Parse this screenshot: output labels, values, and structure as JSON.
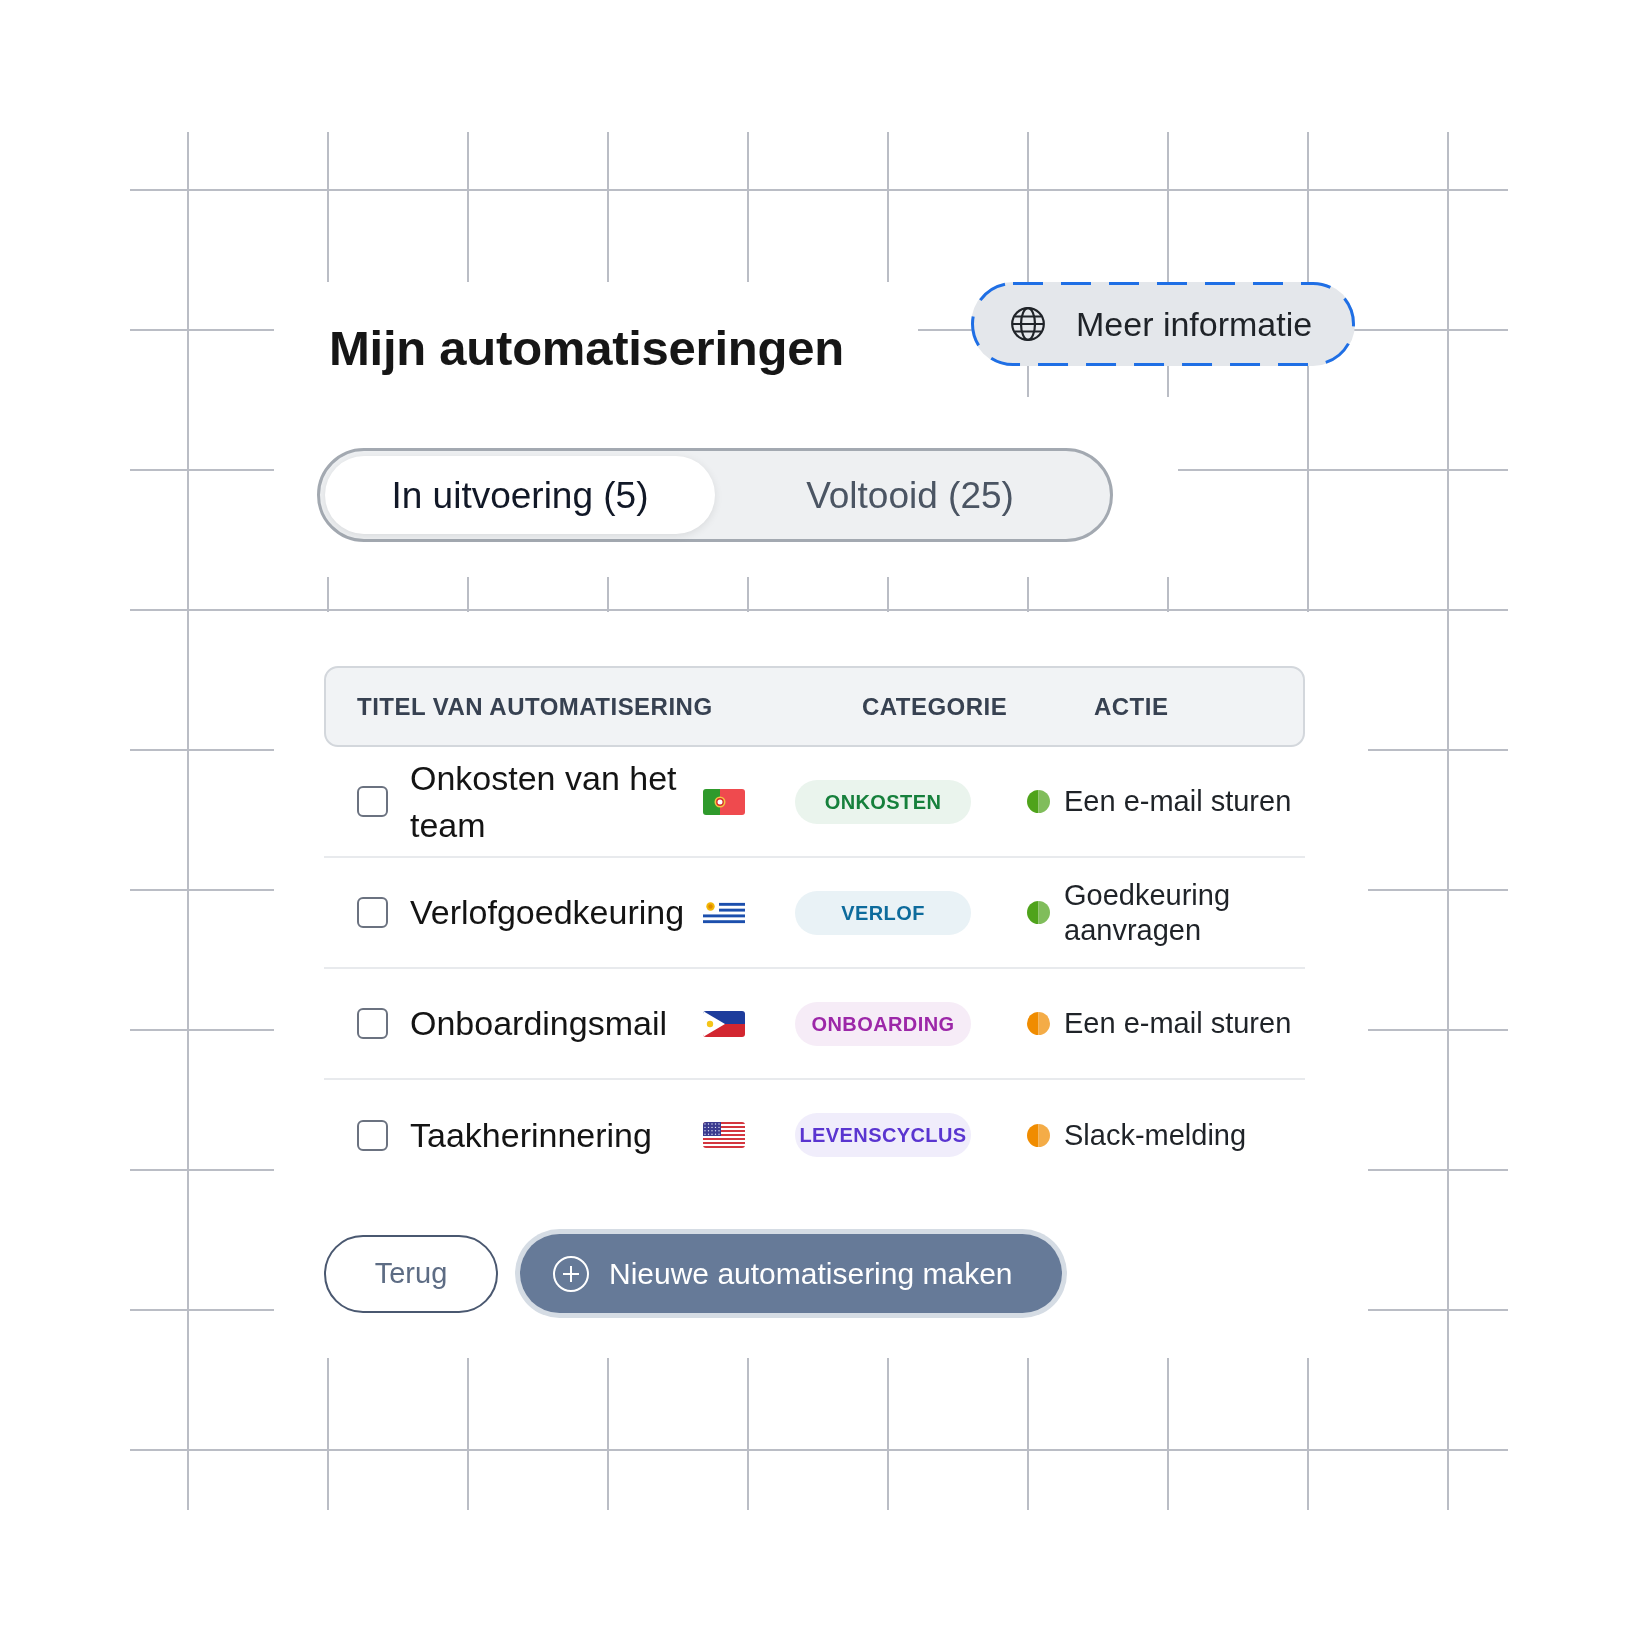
{
  "title": "Mijn automatiseringen",
  "info_button": {
    "label": "Meer informatie"
  },
  "tabs": [
    {
      "label": "In uitvoering (5)",
      "selected": true
    },
    {
      "label": "Voltooid (25)",
      "selected": false
    }
  ],
  "table": {
    "columns": [
      "TITEL VAN AUTOMATISERING",
      "CATEGORIE",
      "ACTIE"
    ],
    "rows": [
      {
        "checked": false,
        "title": "Onkosten van het team",
        "flag": {
          "kind": "portugal"
        },
        "category": {
          "label": "ONKOSTEN",
          "color": "#16803c"
        },
        "action": {
          "label": "Een e-mail sturen",
          "color": "#4fa31b"
        }
      },
      {
        "checked": false,
        "title": "Verlofgoedkeuring",
        "flag": {
          "kind": "uruguay"
        },
        "category": {
          "label": "VERLOF",
          "color": "#0d6b9c"
        },
        "action": {
          "label": "Goedkeuring aanvragen",
          "color": "#4fa31b"
        }
      },
      {
        "checked": false,
        "title": "Onboardingsmail",
        "flag": {
          "kind": "philippines"
        },
        "category": {
          "label": "ONBOARDING",
          "color": "#9c27a8"
        },
        "action": {
          "label": "Een e-mail sturen",
          "color": "#f08c00"
        }
      },
      {
        "checked": false,
        "title": "Taakherinnering",
        "flag": {
          "kind": "usa"
        },
        "category": {
          "label": "LEVENSCYCLUS",
          "color": "#5a35d0"
        },
        "action": {
          "label": "Slack-melding",
          "color": "#f08c00"
        }
      }
    ]
  },
  "buttons": [
    {
      "kind": "secondary",
      "label": "Terug"
    },
    {
      "kind": "primary",
      "label": "Nieuwe automatisering maken"
    }
  ]
}
